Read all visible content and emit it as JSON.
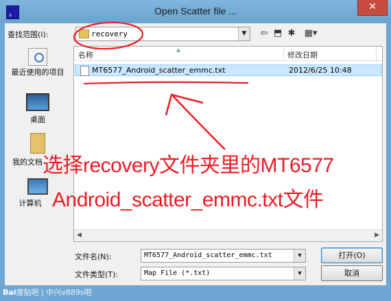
{
  "window": {
    "title": "Open Scatter file ...",
    "close_glyph": "✕",
    "app_icon_text": "s"
  },
  "lookin": {
    "label": "查找范围(I):",
    "value": "recovery"
  },
  "toolbar": {
    "back_glyph": "⇦",
    "up_glyph": "⬒",
    "newfolder_glyph": "✱",
    "view_glyph": "▦▾"
  },
  "places": [
    {
      "label": "最近使用的项目"
    },
    {
      "label": "桌面"
    },
    {
      "label": "我的文档"
    },
    {
      "label": "计算机"
    }
  ],
  "filelist": {
    "columns": {
      "name": "名称",
      "date": "修改日期"
    },
    "rows": [
      {
        "name": "MT6577_Android_scatter_emmc.txt",
        "date": "2012/6/25 10:48"
      }
    ]
  },
  "annotation": {
    "line1": "选择recovery文件夹里的MT6577",
    "line2": "Android_scatter_emmc.txt文件",
    "color": "#ec1c24"
  },
  "filename": {
    "label": "文件名(N):",
    "value": "MT6577_Android_scatter_emmc.txt"
  },
  "filetype": {
    "label": "文件类型(T):",
    "value": "Map File (*.txt)"
  },
  "buttons": {
    "open": "打开(O)",
    "cancel": "取消"
  },
  "watermark": {
    "logo": "Bai",
    "text": "度贴吧 | 中兴v889s吧"
  }
}
